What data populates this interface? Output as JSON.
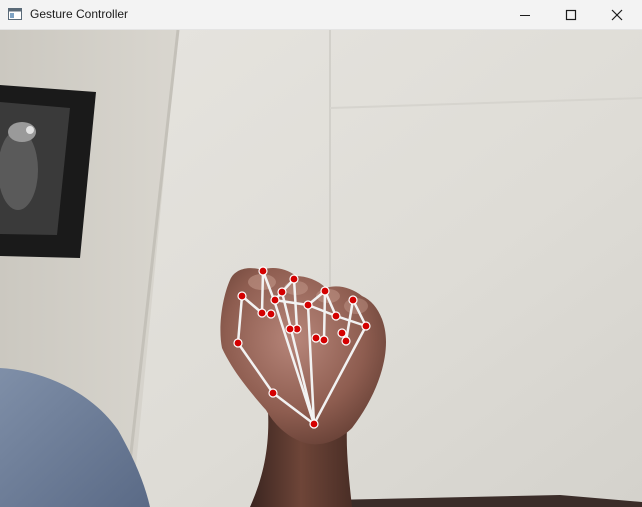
{
  "window": {
    "title": "Gesture Controller",
    "icons": {
      "app": "app-window-icon",
      "minimize": "minimize-icon",
      "maximize": "maximize-icon",
      "close": "close-icon"
    }
  },
  "video_feed": {
    "description_icon": "camera-feed",
    "landmark_color": "#d40000",
    "connection_color": "#f5f5f5"
  }
}
